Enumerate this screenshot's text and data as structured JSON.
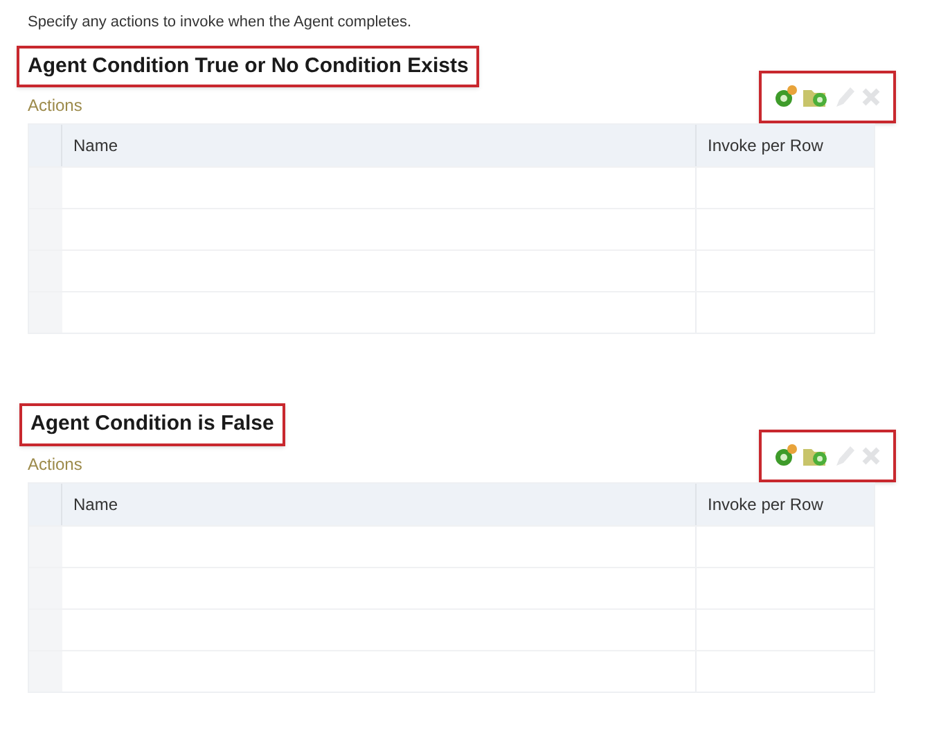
{
  "intro": "Specify any actions to invoke when the Agent completes.",
  "sections": [
    {
      "heading": "Agent Condition True or No Condition Exists",
      "label": "Actions",
      "toolbar": [
        {
          "kind": "add",
          "disabled": false
        },
        {
          "kind": "add-existing",
          "disabled": false
        },
        {
          "kind": "edit",
          "disabled": true
        },
        {
          "kind": "delete",
          "disabled": true
        }
      ],
      "columns": [
        "Name",
        "Invoke per Row"
      ]
    },
    {
      "heading": "Agent Condition is False",
      "label": "Actions",
      "toolbar": [
        {
          "kind": "add",
          "disabled": false
        },
        {
          "kind": "add-existing",
          "disabled": false
        },
        {
          "kind": "edit",
          "disabled": true
        },
        {
          "kind": "delete",
          "disabled": true
        }
      ],
      "columns": [
        "Name",
        "Invoke per Row"
      ]
    }
  ]
}
